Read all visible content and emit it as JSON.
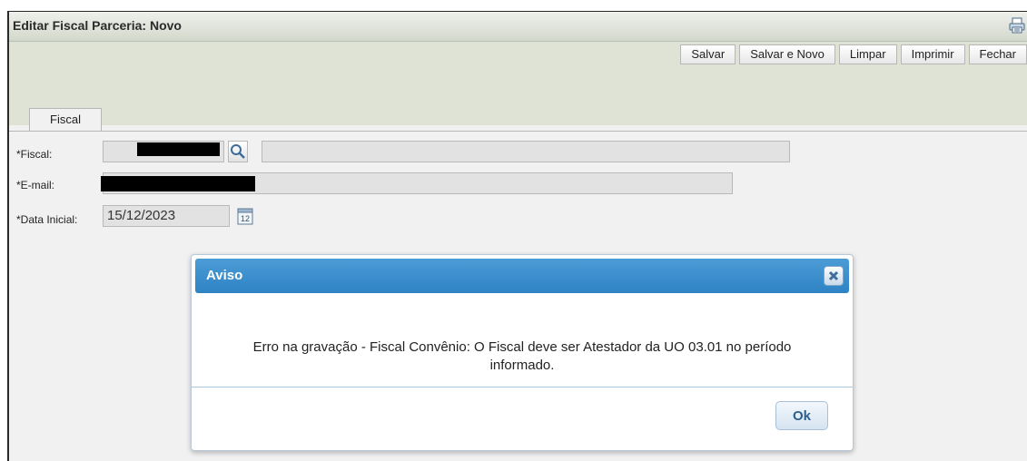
{
  "window": {
    "title": "Editar Fiscal Parceria: Novo"
  },
  "toolbar": {
    "buttons": [
      {
        "label": "Salvar"
      },
      {
        "label": "Salvar e Novo"
      },
      {
        "label": "Limpar"
      },
      {
        "label": "Imprimir"
      },
      {
        "label": "Fechar"
      }
    ]
  },
  "tabs": [
    {
      "label": "Fiscal"
    }
  ],
  "form": {
    "fiscal": {
      "label": "*Fiscal:",
      "icon": "search-icon"
    },
    "email": {
      "label": "*E-mail:"
    },
    "data_inicial": {
      "label": "*Data Inicial:",
      "value": "15/12/2023",
      "icon": "calendar-icon",
      "calendar_day": "12"
    }
  },
  "dialog": {
    "title": "Aviso",
    "message_line1": "Erro na gravação - Fiscal Convênio: O Fiscal deve ser Atestador da UO 03.01 no período",
    "message_line2": "informado.",
    "ok_label": "Ok",
    "colors": {
      "header": "#2f83c4",
      "ok_text": "#2b5e8f"
    }
  }
}
